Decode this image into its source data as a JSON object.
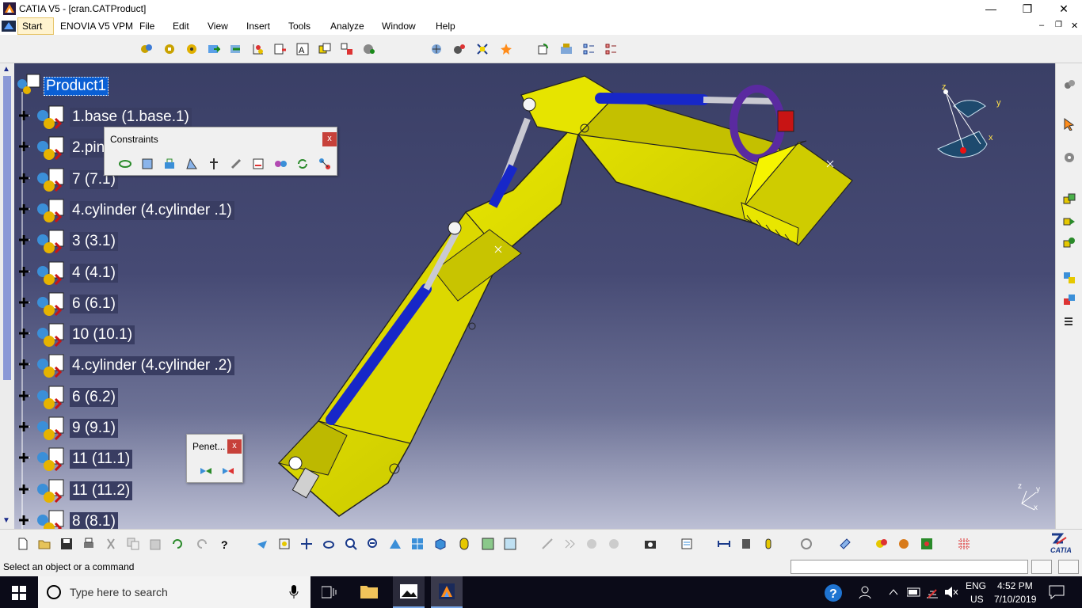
{
  "window": {
    "title": "CATIA V5 - [cran.CATProduct]",
    "controls": {
      "minimize": "—",
      "maximize": "❐",
      "close": "✕"
    },
    "doc_controls": {
      "minimize": "–",
      "restore": "❐",
      "close": "✕"
    }
  },
  "menu": {
    "items": [
      "Start",
      "ENOVIA V5 VPM",
      "File",
      "Edit",
      "View",
      "Insert",
      "Tools",
      "Analyze",
      "Window",
      "Help"
    ]
  },
  "tree": {
    "root": "Product1",
    "items": [
      "1.base (1.base.1)",
      "2.pin",
      "7 (7.1)",
      "4.cylinder  (4.cylinder .1)",
      "3 (3.1)",
      "4 (4.1)",
      "6 (6.1)",
      "10 (10.1)",
      "4.cylinder  (4.cylinder .2)",
      "6 (6.2)",
      "9 (9.1)",
      "11 (11.1)",
      "11 (11.2)",
      "8 (8.1)"
    ]
  },
  "constraints_palette": {
    "title": "Constraints",
    "close": "x"
  },
  "penetration_palette": {
    "title": "Penet...",
    "close": "x"
  },
  "compass": {
    "labels": {
      "x": "x",
      "y": "y",
      "z": "z"
    }
  },
  "axis_triad": {
    "labels": {
      "x": "x",
      "y": "y",
      "z": "z"
    }
  },
  "statusbar": {
    "message": "Select an object or a command",
    "input_value": ""
  },
  "brand": {
    "name": "CATIA"
  },
  "taskbar": {
    "search_placeholder": "Type here to search",
    "language": "ENG",
    "region": "US",
    "time": "4:52 PM",
    "date": "7/10/2019"
  },
  "colors": {
    "viewport_top": "#3a3f66",
    "viewport_bottom": "#bcbfd4",
    "part_yellow": "#e8e600",
    "cylinder_blue": "#1727c8",
    "selection_blue": "#0a5fd4",
    "bucket_purple": "#5a2aa0"
  }
}
